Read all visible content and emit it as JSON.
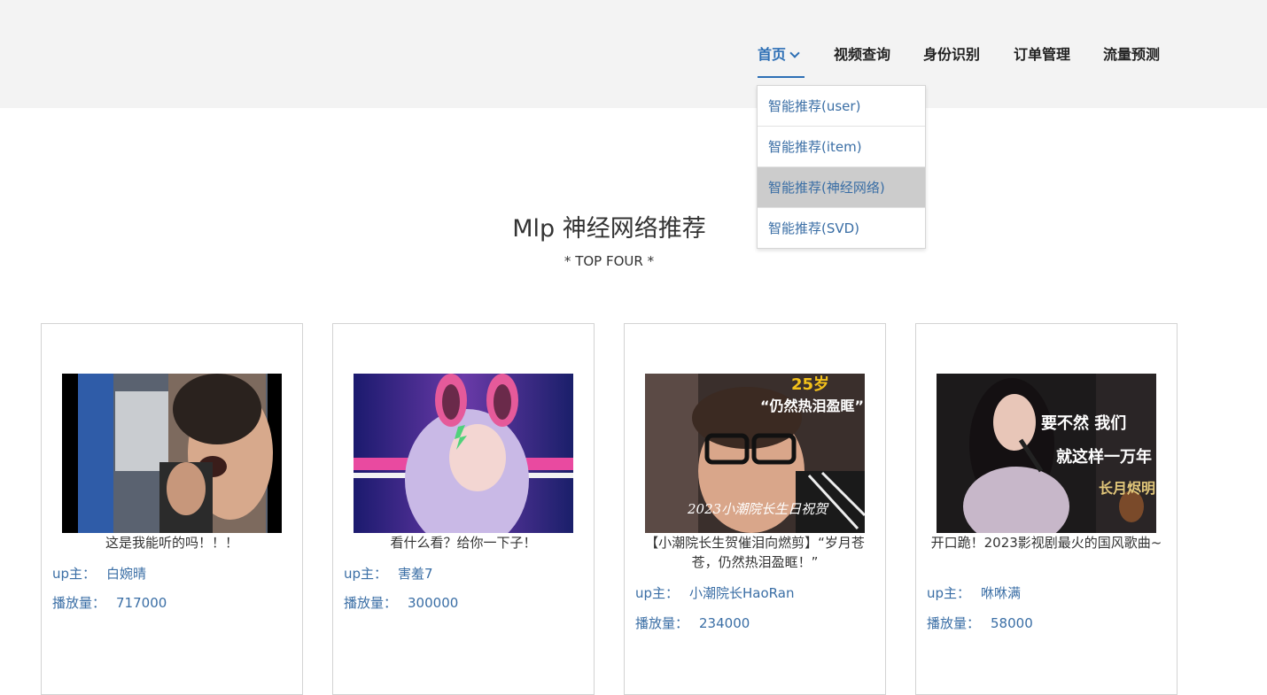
{
  "nav": {
    "items": [
      {
        "label": "首页",
        "active": true
      },
      {
        "label": "视频查询"
      },
      {
        "label": "身份识别"
      },
      {
        "label": "订单管理"
      },
      {
        "label": "流量预测"
      }
    ]
  },
  "dropdown": {
    "items": [
      {
        "label": "智能推荐(user)"
      },
      {
        "label": "智能推荐(item)"
      },
      {
        "label": "智能推荐(神经网络)",
        "highlighted": true
      },
      {
        "label": "智能推荐(SVD)"
      }
    ]
  },
  "page": {
    "title": "Mlp 神经网络推荐",
    "subtitle": "* TOP FOUR *"
  },
  "cards": [
    {
      "title": "这是我能听的吗！！！",
      "up_label": "up主：",
      "up_name": "白婉晴",
      "views_label": "播放量：",
      "views": "717000"
    },
    {
      "title": "看什么看？给你一下子！",
      "up_label": "up主：",
      "up_name": "害羞7",
      "views_label": "播放量：",
      "views": "300000"
    },
    {
      "title": "【小潮院长生贺催泪向燃剪】“岁月苍苍，仍然热泪盈眶！”",
      "up_label": "up主：",
      "up_name": "小潮院长HaoRan",
      "views_label": "播放量：",
      "views": "234000"
    },
    {
      "title": "开口跪！2023影视剧最火的国风歌曲~",
      "up_label": "up主：",
      "up_name": "咻咻满",
      "views_label": "播放量：",
      "views": "58000"
    }
  ],
  "thumb_captions": {
    "card3_top": "25岁",
    "card3_quote": "“仍然热泪盈眶”",
    "card3_bottom": "2023小潮院长生日祝贺",
    "card4_line1": "要不然 我们",
    "card4_line2": "就这样一万年",
    "card4_logo": "长月烬明"
  },
  "colors": {
    "accent": "#2d6fb5",
    "link": "#3a6ea5",
    "header_bg": "#f3f3f3",
    "dropdown_hover": "#cccccc"
  }
}
